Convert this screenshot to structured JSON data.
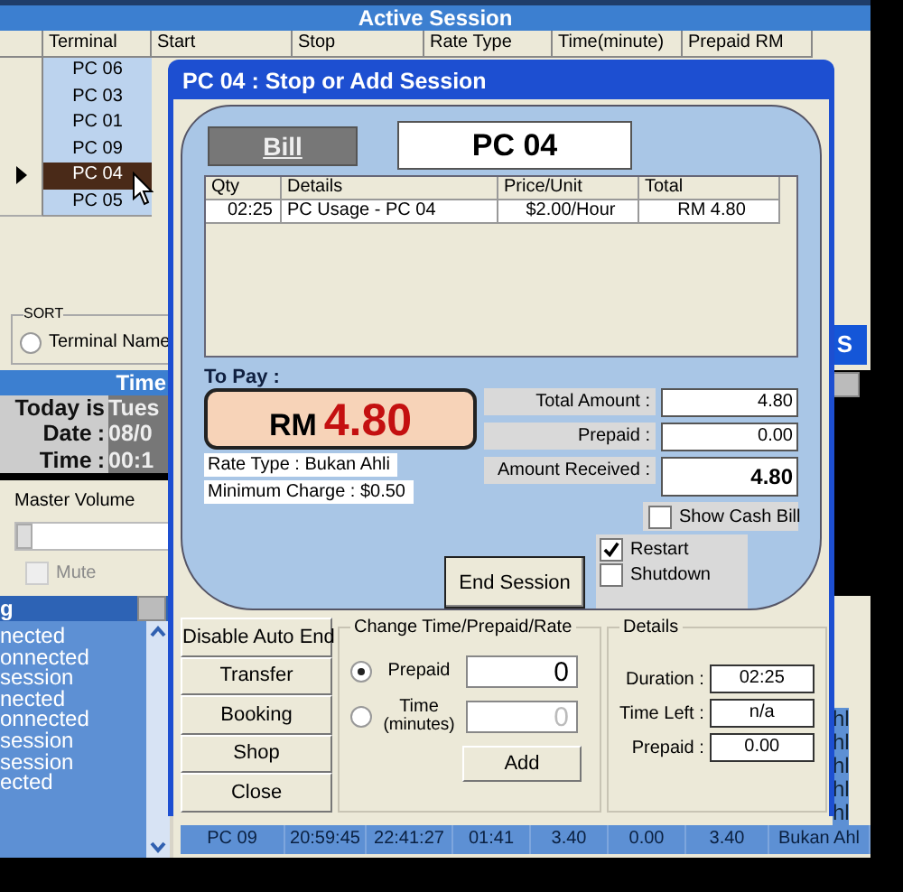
{
  "background": {
    "session_panel": {
      "title": "Active Session",
      "columns": [
        "Terminal",
        "Start",
        "Stop",
        "Rate Type",
        "Time(minute)",
        "Prepaid RM"
      ],
      "rows": [
        {
          "terminal": "PC 06",
          "selected": false
        },
        {
          "terminal": "PC 03",
          "selected": false
        },
        {
          "terminal": "PC 01",
          "selected": false
        },
        {
          "terminal": "PC 09",
          "selected": false
        },
        {
          "terminal": "PC 04",
          "selected": true
        },
        {
          "terminal": "PC 05",
          "selected": false
        }
      ]
    },
    "sort": {
      "title": "SORT",
      "option": "Terminal Name",
      "selected": false
    },
    "side_button": "S",
    "time_panel": {
      "title": "Time",
      "rows": [
        {
          "label": "Today is",
          "separator": "",
          "value": "Tues"
        },
        {
          "label": "Date",
          "separator": ":",
          "value": "08/0"
        },
        {
          "label": "Time",
          "separator": ":",
          "value": "00:1"
        }
      ]
    },
    "volume": {
      "label": "Master Volume",
      "level": 0,
      "mute": {
        "label": "Mute",
        "checked": false,
        "disabled": true
      }
    },
    "log": {
      "title": "g",
      "items": [
        "nected",
        "onnected",
        "session",
        "nected",
        "onnected",
        "session",
        "session",
        "ected"
      ]
    },
    "cut_cells": [
      "hl",
      "hl",
      "hl",
      "hl",
      "hl"
    ],
    "bottom_row": [
      "PC 09",
      "20:59:45",
      "22:41:27",
      "01:41",
      "3.40",
      "0.00",
      "3.40",
      "Bukan Ahl"
    ]
  },
  "dialog": {
    "title": "PC 04 : Stop or Add Session",
    "bill_button": "Bill",
    "terminal": "PC 04",
    "items": {
      "columns": [
        "Qty",
        "Details",
        "Price/Unit",
        "Total"
      ],
      "rows": [
        [
          "02:25",
          "PC Usage - PC 04",
          "$2.00/Hour",
          "RM 4.80"
        ]
      ]
    },
    "to_pay_label": "To Pay :",
    "currency": "RM",
    "amount": "4.80",
    "rate_type": "Rate Type : Bukan Ahli",
    "minimum_charge": "Minimum Charge : $0.50",
    "totals": [
      {
        "label": "Total Amount  :",
        "value": "4.80",
        "kind": "plain"
      },
      {
        "label": "Prepaid  :",
        "value": "0.00",
        "kind": "plain"
      },
      {
        "label": "Amount Received  :",
        "value": "4.80",
        "kind": "bold"
      }
    ],
    "show_cash_bill": {
      "label": "Show Cash Bill",
      "checked": false
    },
    "end_session_button": "End Session",
    "power_options": [
      {
        "label": "Restart",
        "checked": true
      },
      {
        "label": "Shutdown",
        "checked": false
      }
    ],
    "side_buttons": [
      "Disable Auto End",
      "Transfer",
      "Booking",
      "Shop",
      "Close"
    ],
    "change_group": {
      "title": "Change Time/Prepaid/Rate",
      "options": [
        {
          "label": "Prepaid",
          "selected": true,
          "value": "0"
        },
        {
          "label": "Time",
          "sublabel": "(minutes)",
          "selected": false,
          "value": "0"
        }
      ],
      "add_button": "Add"
    },
    "details": {
      "title": "Details",
      "rows": [
        {
          "label": "Duration :",
          "value": "02:25"
        },
        {
          "label": "Time Left :",
          "value": "n/a"
        },
        {
          "label": "Prepaid :",
          "value": "0.00"
        }
      ]
    }
  }
}
